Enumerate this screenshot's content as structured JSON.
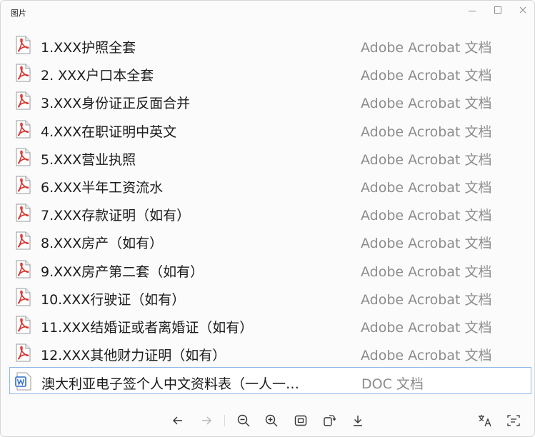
{
  "window": {
    "title": "图片"
  },
  "files": [
    {
      "name": "1.XXX护照全套",
      "type": "Adobe Acrobat 文档",
      "icon": "pdf-icon"
    },
    {
      "name": "2. XXX户口本全套",
      "type": "Adobe Acrobat 文档",
      "icon": "pdf-icon"
    },
    {
      "name": "3.XXX身份证正反面合并",
      "type": "Adobe Acrobat 文档",
      "icon": "pdf-icon"
    },
    {
      "name": "4.XXX在职证明中英文",
      "type": "Adobe Acrobat 文档",
      "icon": "pdf-icon"
    },
    {
      "name": "5.XXX营业执照",
      "type": "Adobe Acrobat 文档",
      "icon": "pdf-icon"
    },
    {
      "name": "6.XXX半年工资流水",
      "type": "Adobe Acrobat 文档",
      "icon": "pdf-icon"
    },
    {
      "name": "7.XXX存款证明（如有）",
      "type": "Adobe Acrobat 文档",
      "icon": "pdf-icon"
    },
    {
      "name": "8.XXX房产（如有）",
      "type": "Adobe Acrobat 文档",
      "icon": "pdf-icon"
    },
    {
      "name": "9.XXX房产第二套（如有）",
      "type": "Adobe Acrobat 文档",
      "icon": "pdf-icon"
    },
    {
      "name": "10.XXX行驶证（如有）",
      "type": "Adobe Acrobat 文档",
      "icon": "pdf-icon"
    },
    {
      "name": "11.XXX结婚证或者离婚证（如有）",
      "type": "Adobe Acrobat 文档",
      "icon": "pdf-icon"
    },
    {
      "name": "12.XXX其他财力证明（如有）",
      "type": "Adobe Acrobat 文档",
      "icon": "pdf-icon"
    },
    {
      "name": "澳大利亚电子签个人中文资料表（一人一…",
      "type": "DOC 文档",
      "icon": "word-doc-icon",
      "selected": true
    }
  ],
  "toolbar": {
    "icons": [
      "back-arrow-icon",
      "forward-arrow-icon",
      "zoom-out-icon",
      "zoom-in-icon",
      "actual-size-icon",
      "rotate-icon",
      "download-icon",
      "translate-icon",
      "text-recognition-icon"
    ]
  },
  "colors": {
    "pdf_red": "#d9312b",
    "word_blue": "#2b6cc4",
    "selection_border": "#8eb7e6",
    "type_text": "#8c8c8c"
  }
}
